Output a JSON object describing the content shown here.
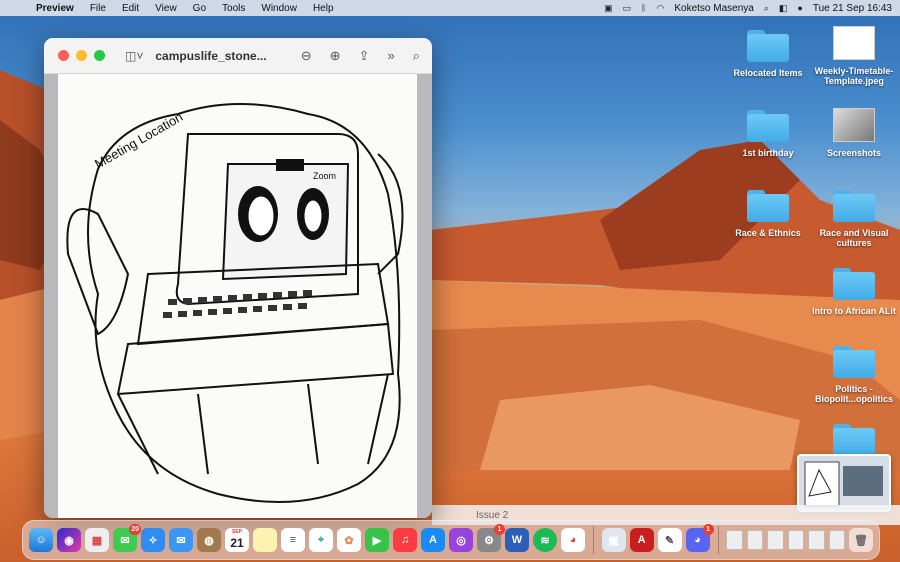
{
  "menubar": {
    "app_name": "Preview",
    "menus": [
      "File",
      "Edit",
      "View",
      "Go",
      "Tools",
      "Window",
      "Help"
    ],
    "user": "Koketso Masenya",
    "datetime": "Tue 21 Sep  16:43"
  },
  "window": {
    "title": "campuslife_stone...",
    "illustration_text": {
      "sign": "Meeting Location",
      "screen": "Zoom"
    }
  },
  "background_window": {
    "title": "Issue 2"
  },
  "desktop": {
    "items": [
      {
        "label": "Relocated Items",
        "kind": "folder"
      },
      {
        "label": "Weekly-Timetable-Template.jpeg",
        "kind": "image"
      },
      {
        "label": "1st birthday",
        "kind": "folder"
      },
      {
        "label": "Screenshots",
        "kind": "stack"
      },
      {
        "label": "Race & Ethnics",
        "kind": "folder"
      },
      {
        "label": "Race and Visual cultures",
        "kind": "folder"
      },
      {
        "label": "Intro to African ALit",
        "kind": "folder"
      },
      {
        "label": "Politics -Biopolit...opolitics",
        "kind": "folder"
      }
    ]
  },
  "dock": {
    "calendar_month": "SEP",
    "calendar_day": "21",
    "messages_badge": "20",
    "settings_badge": "1",
    "discord_badge": "1"
  }
}
